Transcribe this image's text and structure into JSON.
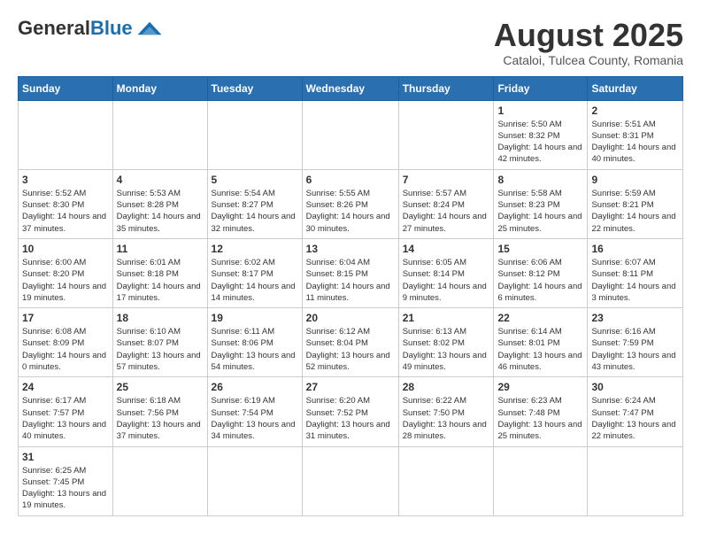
{
  "header": {
    "logo_general": "General",
    "logo_blue": "Blue",
    "title": "August 2025",
    "subtitle": "Cataloi, Tulcea County, Romania"
  },
  "weekdays": [
    "Sunday",
    "Monday",
    "Tuesday",
    "Wednesday",
    "Thursday",
    "Friday",
    "Saturday"
  ],
  "weeks": [
    [
      {
        "day": "",
        "info": ""
      },
      {
        "day": "",
        "info": ""
      },
      {
        "day": "",
        "info": ""
      },
      {
        "day": "",
        "info": ""
      },
      {
        "day": "",
        "info": ""
      },
      {
        "day": "1",
        "info": "Sunrise: 5:50 AM\nSunset: 8:32 PM\nDaylight: 14 hours and 42 minutes."
      },
      {
        "day": "2",
        "info": "Sunrise: 5:51 AM\nSunset: 8:31 PM\nDaylight: 14 hours and 40 minutes."
      }
    ],
    [
      {
        "day": "3",
        "info": "Sunrise: 5:52 AM\nSunset: 8:30 PM\nDaylight: 14 hours and 37 minutes."
      },
      {
        "day": "4",
        "info": "Sunrise: 5:53 AM\nSunset: 8:28 PM\nDaylight: 14 hours and 35 minutes."
      },
      {
        "day": "5",
        "info": "Sunrise: 5:54 AM\nSunset: 8:27 PM\nDaylight: 14 hours and 32 minutes."
      },
      {
        "day": "6",
        "info": "Sunrise: 5:55 AM\nSunset: 8:26 PM\nDaylight: 14 hours and 30 minutes."
      },
      {
        "day": "7",
        "info": "Sunrise: 5:57 AM\nSunset: 8:24 PM\nDaylight: 14 hours and 27 minutes."
      },
      {
        "day": "8",
        "info": "Sunrise: 5:58 AM\nSunset: 8:23 PM\nDaylight: 14 hours and 25 minutes."
      },
      {
        "day": "9",
        "info": "Sunrise: 5:59 AM\nSunset: 8:21 PM\nDaylight: 14 hours and 22 minutes."
      }
    ],
    [
      {
        "day": "10",
        "info": "Sunrise: 6:00 AM\nSunset: 8:20 PM\nDaylight: 14 hours and 19 minutes."
      },
      {
        "day": "11",
        "info": "Sunrise: 6:01 AM\nSunset: 8:18 PM\nDaylight: 14 hours and 17 minutes."
      },
      {
        "day": "12",
        "info": "Sunrise: 6:02 AM\nSunset: 8:17 PM\nDaylight: 14 hours and 14 minutes."
      },
      {
        "day": "13",
        "info": "Sunrise: 6:04 AM\nSunset: 8:15 PM\nDaylight: 14 hours and 11 minutes."
      },
      {
        "day": "14",
        "info": "Sunrise: 6:05 AM\nSunset: 8:14 PM\nDaylight: 14 hours and 9 minutes."
      },
      {
        "day": "15",
        "info": "Sunrise: 6:06 AM\nSunset: 8:12 PM\nDaylight: 14 hours and 6 minutes."
      },
      {
        "day": "16",
        "info": "Sunrise: 6:07 AM\nSunset: 8:11 PM\nDaylight: 14 hours and 3 minutes."
      }
    ],
    [
      {
        "day": "17",
        "info": "Sunrise: 6:08 AM\nSunset: 8:09 PM\nDaylight: 14 hours and 0 minutes."
      },
      {
        "day": "18",
        "info": "Sunrise: 6:10 AM\nSunset: 8:07 PM\nDaylight: 13 hours and 57 minutes."
      },
      {
        "day": "19",
        "info": "Sunrise: 6:11 AM\nSunset: 8:06 PM\nDaylight: 13 hours and 54 minutes."
      },
      {
        "day": "20",
        "info": "Sunrise: 6:12 AM\nSunset: 8:04 PM\nDaylight: 13 hours and 52 minutes."
      },
      {
        "day": "21",
        "info": "Sunrise: 6:13 AM\nSunset: 8:02 PM\nDaylight: 13 hours and 49 minutes."
      },
      {
        "day": "22",
        "info": "Sunrise: 6:14 AM\nSunset: 8:01 PM\nDaylight: 13 hours and 46 minutes."
      },
      {
        "day": "23",
        "info": "Sunrise: 6:16 AM\nSunset: 7:59 PM\nDaylight: 13 hours and 43 minutes."
      }
    ],
    [
      {
        "day": "24",
        "info": "Sunrise: 6:17 AM\nSunset: 7:57 PM\nDaylight: 13 hours and 40 minutes."
      },
      {
        "day": "25",
        "info": "Sunrise: 6:18 AM\nSunset: 7:56 PM\nDaylight: 13 hours and 37 minutes."
      },
      {
        "day": "26",
        "info": "Sunrise: 6:19 AM\nSunset: 7:54 PM\nDaylight: 13 hours and 34 minutes."
      },
      {
        "day": "27",
        "info": "Sunrise: 6:20 AM\nSunset: 7:52 PM\nDaylight: 13 hours and 31 minutes."
      },
      {
        "day": "28",
        "info": "Sunrise: 6:22 AM\nSunset: 7:50 PM\nDaylight: 13 hours and 28 minutes."
      },
      {
        "day": "29",
        "info": "Sunrise: 6:23 AM\nSunset: 7:48 PM\nDaylight: 13 hours and 25 minutes."
      },
      {
        "day": "30",
        "info": "Sunrise: 6:24 AM\nSunset: 7:47 PM\nDaylight: 13 hours and 22 minutes."
      }
    ],
    [
      {
        "day": "31",
        "info": "Sunrise: 6:25 AM\nSunset: 7:45 PM\nDaylight: 13 hours and 19 minutes."
      },
      {
        "day": "",
        "info": ""
      },
      {
        "day": "",
        "info": ""
      },
      {
        "day": "",
        "info": ""
      },
      {
        "day": "",
        "info": ""
      },
      {
        "day": "",
        "info": ""
      },
      {
        "day": "",
        "info": ""
      }
    ]
  ]
}
